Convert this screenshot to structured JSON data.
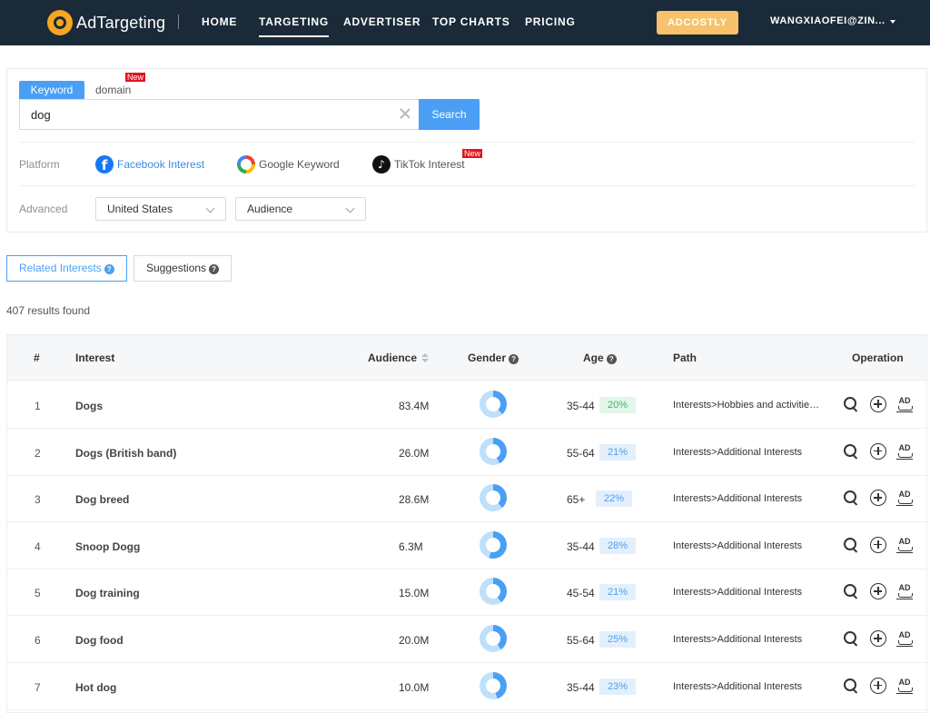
{
  "nav": {
    "logo": "AdTargeting",
    "links": [
      "HOME",
      "TARGETING",
      "ADVERTISER",
      "TOP CHARTS",
      "PRICING"
    ],
    "active": "TARGETING",
    "cta": "ADCOSTLY",
    "user": "WANGXIAOFEI@ZIN..."
  },
  "search": {
    "tabs": {
      "keyword": "Keyword",
      "domain": "domain"
    },
    "new_badge": "New",
    "query": "dog",
    "button": "Search",
    "platform_label": "Platform",
    "platforms": [
      "Facebook Interest",
      "Google Keyword",
      "TikTok Interest"
    ],
    "advanced_label": "Advanced",
    "country": "United States",
    "sort": "Audience"
  },
  "tabs": {
    "related": "Related Interests",
    "suggestions": "Suggestions",
    "help": "?"
  },
  "results": "407 results found",
  "table": {
    "headers": {
      "index": "#",
      "interest": "Interest",
      "audience": "Audience",
      "gender": "Gender",
      "age": "Age",
      "path": "Path",
      "operation": "Operation"
    },
    "rows": [
      {
        "idx": "1",
        "name": "Dogs",
        "audience": "83.4M",
        "age": "35-44",
        "pct": "20%",
        "path": "Interests>Hobbies and activities>Pets",
        "gender_share": 0.38,
        "pill": "green"
      },
      {
        "idx": "2",
        "name": "Dogs (British band)",
        "audience": "26.0M",
        "age": "55-64",
        "pct": "21%",
        "path": "Interests>Additional Interests",
        "gender_share": 0.42,
        "pill": "blue"
      },
      {
        "idx": "3",
        "name": "Dog breed",
        "audience": "28.6M",
        "age": "65+",
        "pct": "22%",
        "path": "Interests>Additional Interests",
        "gender_share": 0.38,
        "pill": "blue"
      },
      {
        "idx": "4",
        "name": "Snoop Dogg",
        "audience": "6.3M",
        "age": "35-44",
        "pct": "28%",
        "path": "Interests>Additional Interests",
        "gender_share": 0.55,
        "pill": "blue"
      },
      {
        "idx": "5",
        "name": "Dog training",
        "audience": "15.0M",
        "age": "45-54",
        "pct": "21%",
        "path": "Interests>Additional Interests",
        "gender_share": 0.4,
        "pill": "blue"
      },
      {
        "idx": "6",
        "name": "Dog food",
        "audience": "20.0M",
        "age": "55-64",
        "pct": "25%",
        "path": "Interests>Additional Interests",
        "gender_share": 0.4,
        "pill": "blue"
      },
      {
        "idx": "7",
        "name": "Hot dog",
        "audience": "10.0M",
        "age": "35-44",
        "pct": "23%",
        "path": "Interests>Additional Interests",
        "gender_share": 0.45,
        "pill": "blue"
      }
    ]
  },
  "colors": {
    "accent": "#4a9ff5",
    "nav_bg": "#1b2a38",
    "cta": "#f7c26b",
    "donut_dark": "#4a9ff5",
    "donut_light": "#bfe0fb"
  },
  "icons": {
    "row_ops": [
      "search-icon",
      "add-circle-icon",
      "ad-icon"
    ]
  }
}
